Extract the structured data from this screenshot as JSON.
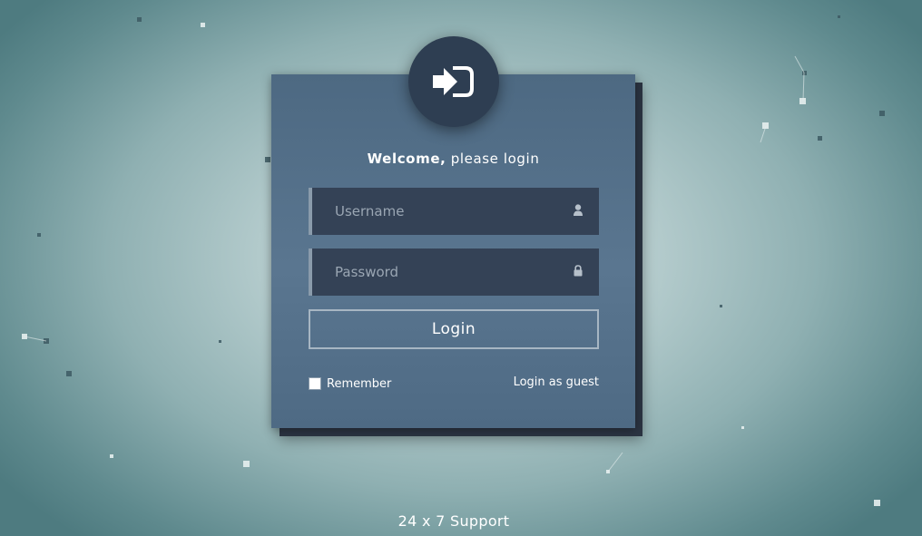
{
  "login_panel": {
    "avatar_icon": "sign-in-icon",
    "welcome_bold": "Welcome,",
    "welcome_rest": " please login",
    "username": {
      "placeholder": "Username",
      "value": "",
      "icon": "user-icon"
    },
    "password": {
      "placeholder": "Password",
      "value": "",
      "icon": "lock-icon"
    },
    "login_label": "Login",
    "remember_label": "Remember",
    "remember_checked": false,
    "guest_label": "Login as guest"
  },
  "footer": {
    "support_label": "24 x 7 Support"
  },
  "colors": {
    "card": "#55718b",
    "field": "#344256",
    "avatar": "#2e3e52",
    "accent_border": "#a7b6c3"
  }
}
